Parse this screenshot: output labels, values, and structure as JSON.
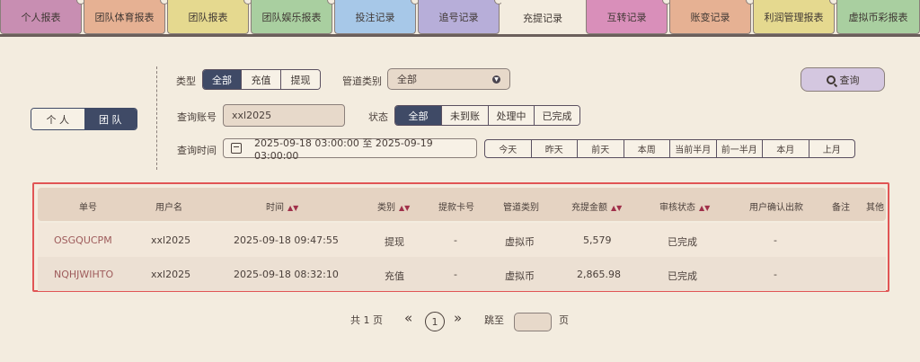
{
  "tabs": [
    {
      "label": "个人报表",
      "color": "#c88eb2"
    },
    {
      "label": "团队体育报表",
      "color": "#e6b193"
    },
    {
      "label": "团队报表",
      "color": "#e5d98f"
    },
    {
      "label": "团队娱乐报表",
      "color": "#a9cfa0"
    },
    {
      "label": "投注记录",
      "color": "#a7c8e8"
    },
    {
      "label": "追号记录",
      "color": "#b7aed9"
    },
    {
      "label": "充提记录",
      "color": "#f3ecdf"
    },
    {
      "label": "互转记录",
      "color": "#d98fba"
    },
    {
      "label": "账变记录",
      "color": "#e6b193"
    },
    {
      "label": "利润管理报表",
      "color": "#e5d98f"
    },
    {
      "label": "虚拟币彩报表",
      "color": "#a9cfa0"
    }
  ],
  "scope_toggle": {
    "personal": "个 人",
    "team": "团 队",
    "selected": "团 队"
  },
  "filters": {
    "type_label": "类型",
    "type_options": [
      "全部",
      "充值",
      "提现"
    ],
    "type_selected": "全部",
    "channel_label": "管道类别",
    "channel_value": "全部",
    "account_label": "查询账号",
    "account_value": "xxl2025",
    "status_label": "状态",
    "status_options": [
      "全部",
      "未到账",
      "处理中",
      "已完成"
    ],
    "status_selected": "全部",
    "time_label": "查询时间",
    "time_range": "2025-09-18 03:00:00 至 2025-09-19 03:00:00",
    "quick_ranges": [
      "今天",
      "昨天",
      "前天",
      "本周",
      "当前半月",
      "前一半月",
      "本月",
      "上月"
    ],
    "query_button": "查询"
  },
  "table": {
    "headers": [
      "单号",
      "用户名",
      "时间",
      "类别",
      "提款卡号",
      "管道类别",
      "充提金额",
      "审核状态",
      "用户确认出款",
      "备注",
      "其他"
    ],
    "rows": [
      [
        "OSGQUCPM",
        "xxl2025",
        "2025-09-18 09:47:55",
        "提现",
        "-",
        "虚拟币",
        "5,579",
        "已完成",
        "-",
        "",
        ""
      ],
      [
        "NQHJWIHTO",
        "xxl2025",
        "2025-09-18 08:32:10",
        "充值",
        "-",
        "虚拟币",
        "2,865.98",
        "已完成",
        "-",
        "",
        ""
      ]
    ]
  },
  "pagination": {
    "total_text": "共 1 页",
    "prev": "«",
    "current": "1",
    "next": "»",
    "jump_label": "跳至",
    "page_unit": "页"
  }
}
